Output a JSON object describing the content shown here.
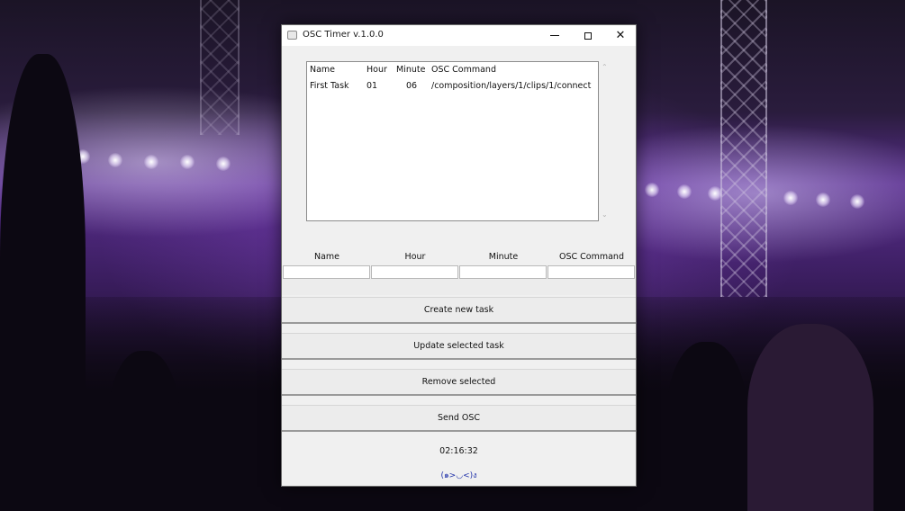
{
  "window": {
    "title": "OSC Timer v.1.0.0",
    "controls": {
      "minimize": "minimize",
      "maximize": "maximize",
      "close": "close"
    }
  },
  "list": {
    "columns": [
      "Name",
      "Hour",
      "Minute",
      "OSC Command"
    ],
    "rows": [
      {
        "name": "First Task",
        "hour": "01",
        "minute": "06",
        "command": "/composition/layers/1/clips/1/connect"
      }
    ]
  },
  "form": {
    "labels": [
      "Name",
      "Hour",
      "Minute",
      "OSC Command"
    ],
    "values": [
      "",
      "",
      "",
      ""
    ]
  },
  "buttons": {
    "create": "Create new task",
    "update": "Update selected task",
    "remove": "Remove  selected",
    "send": "Send OSC"
  },
  "status": {
    "clock": "02:16:32",
    "emoticon": "(๑>◡<)ง"
  },
  "icons": {
    "app": "window-app-icon",
    "scroll_up": "chevron-up-icon",
    "scroll_down": "chevron-down-icon"
  }
}
